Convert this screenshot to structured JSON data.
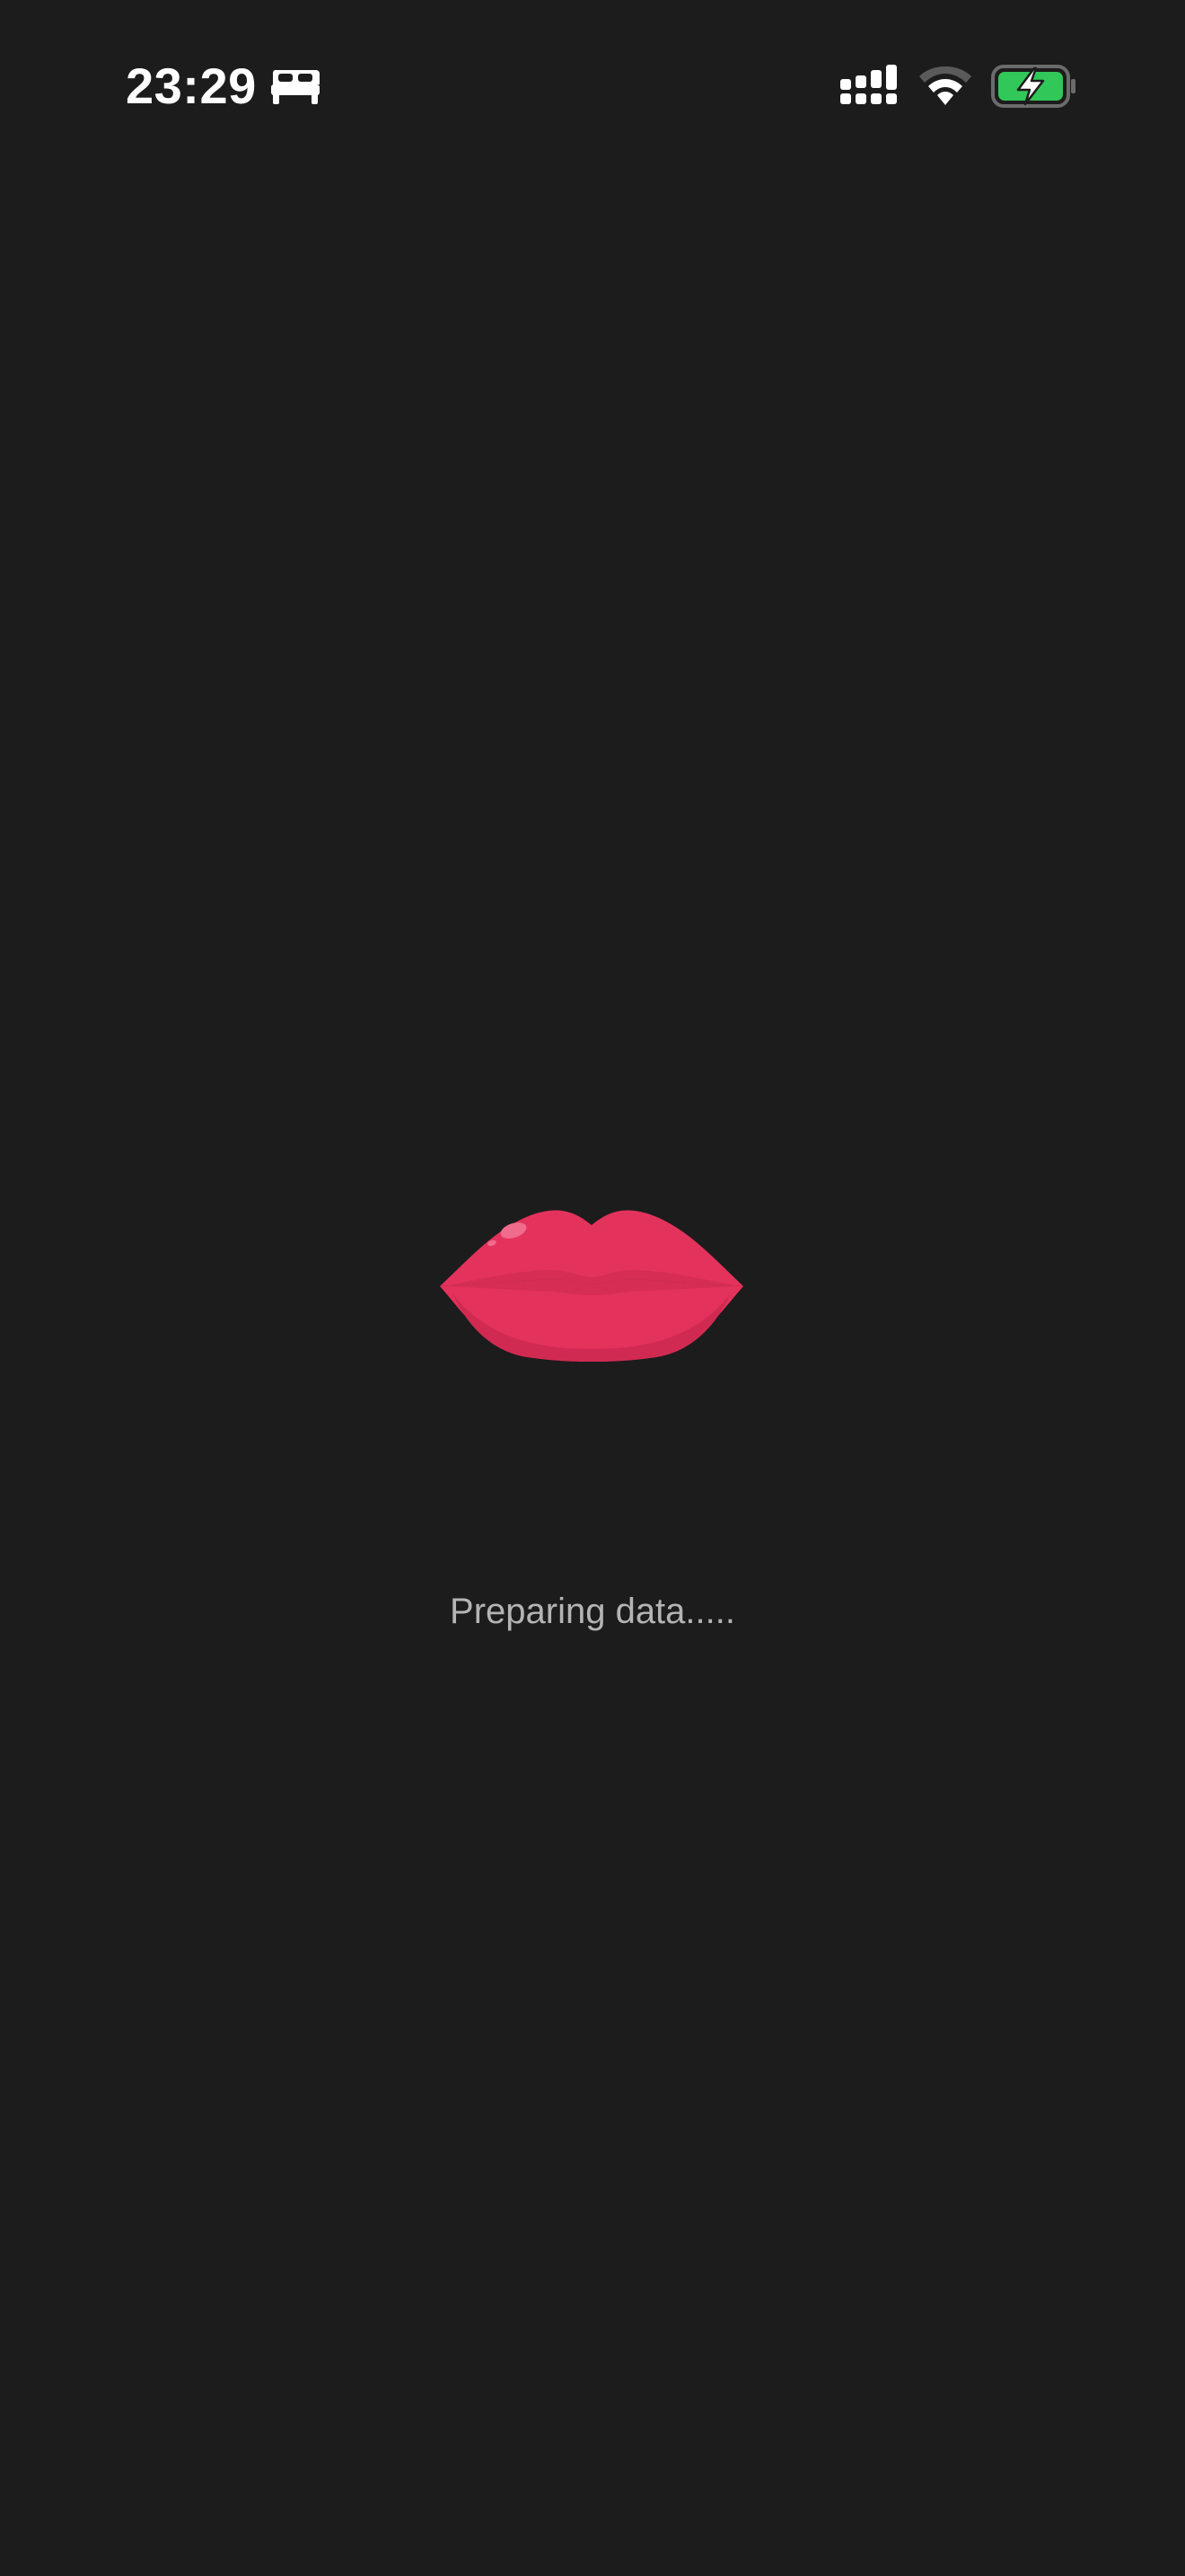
{
  "status_bar": {
    "time": "23:29",
    "focus_mode_icon": "bed-icon",
    "signal_icon": "cellular-signal-icon",
    "wifi_icon": "wifi-icon",
    "battery_icon": "battery-charging-icon",
    "battery_color": "#32c759"
  },
  "splash": {
    "logo_icon": "lips-icon",
    "logo_color": "#e3325c",
    "loading_text": "Preparing data....."
  },
  "colors": {
    "background": "#1c1c1c",
    "loading_text": "#b4b4b4"
  }
}
